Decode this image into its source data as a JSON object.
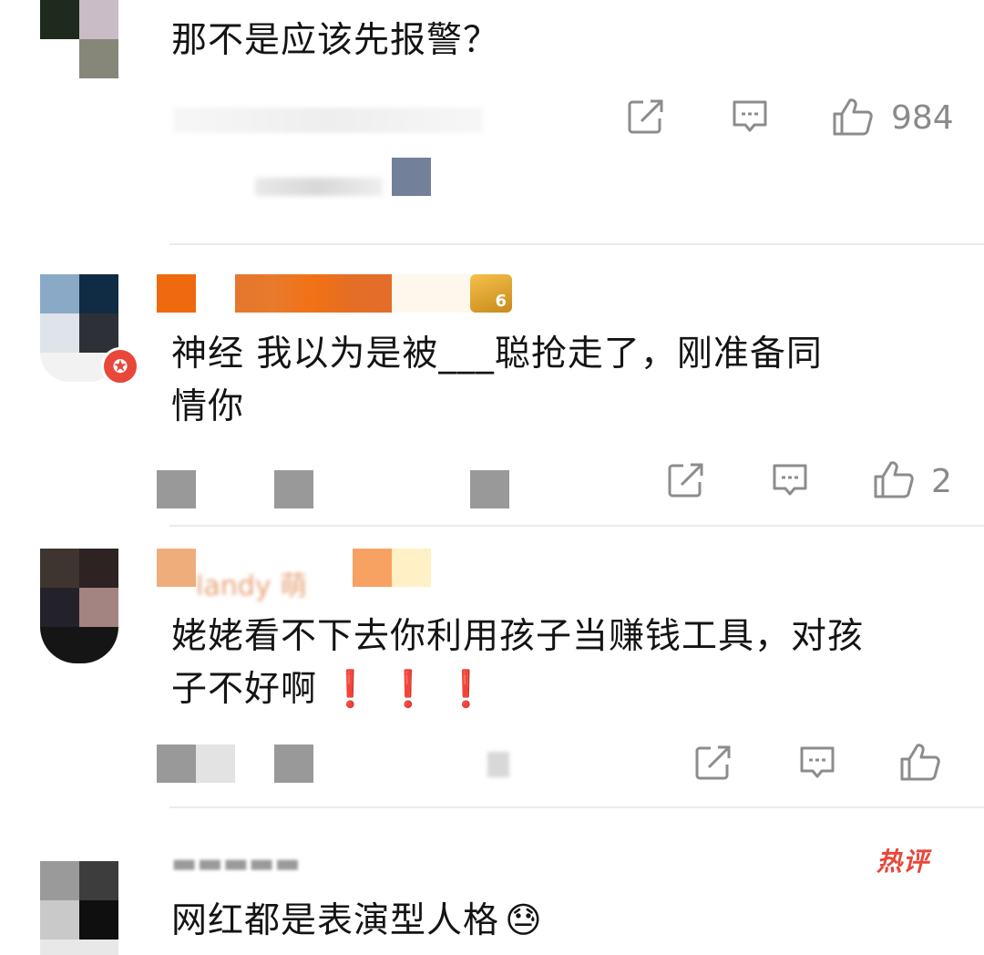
{
  "comments": [
    {
      "text": "那不是应该先报警？",
      "like_count": "984"
    },
    {
      "text": "神经 我以为是被___聪抢走了，刚准备同\n情你",
      "like_count": "2"
    },
    {
      "text": "姥姥看不下去你利用孩子当赚钱工具，对孩\n子不好啊",
      "emphasis": [
        "❗",
        "❗",
        "❗"
      ],
      "like_count": ""
    },
    {
      "text": "网红都是表演型人格",
      "badge": "热评",
      "emoji": "😓"
    }
  ],
  "icons": {
    "share": "share-icon",
    "comment": "comment-icon",
    "like": "thumbs-up-icon"
  },
  "colors": {
    "accent_red": "#e8473a",
    "vip_orange": "#f07a2a"
  }
}
